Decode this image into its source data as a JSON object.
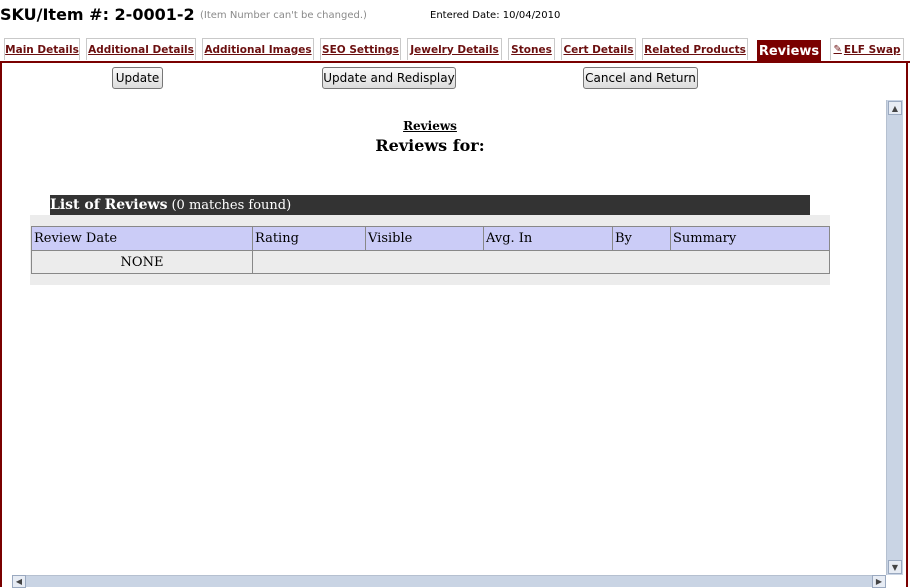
{
  "header": {
    "sku_label": "SKU/Item #: 2-0001-2",
    "sku_note": "(Item Number can't be changed.)",
    "entered_date": "Entered Date: 10/04/2010"
  },
  "tabs": [
    {
      "label": "Main Details"
    },
    {
      "label": "Additional Details"
    },
    {
      "label": "Additional Images"
    },
    {
      "label": "SEO Settings"
    },
    {
      "label": "Jewelry Details"
    },
    {
      "label": "Stones"
    },
    {
      "label": "Cert Details"
    },
    {
      "label": "Related Products"
    },
    {
      "label": "Reviews",
      "active": true
    },
    {
      "label": "ELF Swap",
      "icon": "pen-icon"
    }
  ],
  "buttons": {
    "update": "Update",
    "update_redisplay": "Update and Redisplay",
    "cancel_return": "Cancel and Return"
  },
  "reviews": {
    "link": "Reviews",
    "heading": "Reviews for:",
    "list_title": "List of Reviews",
    "list_count": "(0 matches found)",
    "columns": [
      "Review Date",
      "Rating",
      "Visible",
      "Avg. In",
      "By",
      "Summary"
    ],
    "empty_text": "NONE"
  },
  "colors": {
    "accent": "#7a0000",
    "header_row": "#cbccf7",
    "list_bar": "#333333"
  }
}
